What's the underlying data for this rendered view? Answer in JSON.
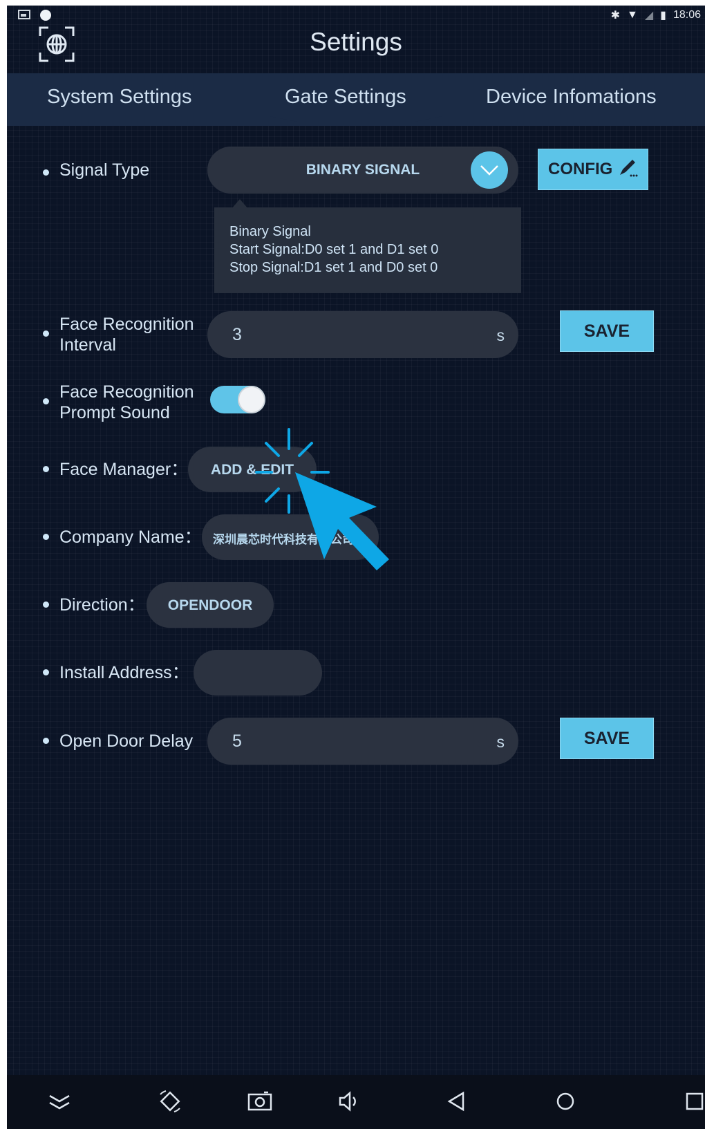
{
  "status_bar": {
    "time": "18:06"
  },
  "header": {
    "title": "Settings"
  },
  "tabs": [
    {
      "label": "System Settings"
    },
    {
      "label": "Gate Settings",
      "active": true
    },
    {
      "label": "Device Infomations"
    }
  ],
  "signal_type": {
    "label": "Signal Type",
    "value": "BINARY SIGNAL",
    "config_label": "CONFIG",
    "popup": [
      "Binary Signal",
      "Start Signal:D0 set 1 and D1 set 0",
      "Stop Signal:D1 set 1 and D0 set 0"
    ]
  },
  "face_interval": {
    "label_line1": "Face Recognition",
    "label_line2": "Interval",
    "value": "3",
    "unit": "s",
    "save_label": "SAVE"
  },
  "prompt_sound": {
    "label_line1": "Face Recognition",
    "label_line2": "Prompt Sound",
    "enabled": true
  },
  "face_manager": {
    "label": "Face Manager：",
    "button_label": "ADD & EDIT"
  },
  "company_name": {
    "label": "Company Name：",
    "value": "深圳晨芯时代科技有限公司"
  },
  "direction": {
    "label": "Direction：",
    "value": "OPENDOOR"
  },
  "install_address": {
    "label": "Install Address：",
    "value": ""
  },
  "open_door_delay": {
    "label": "Open Door Delay",
    "value": "5",
    "unit": "s",
    "save_label": "SAVE"
  },
  "colors": {
    "accent": "#5cc4e8",
    "background": "#0b1426",
    "tab_bar": "#1b2b45",
    "pointer": "#0ea7e6"
  },
  "nav_icons": [
    "collapse-icon",
    "rotate-icon",
    "screenshot-icon",
    "volume-icon",
    "back-icon",
    "home-icon",
    "recents-icon"
  ]
}
